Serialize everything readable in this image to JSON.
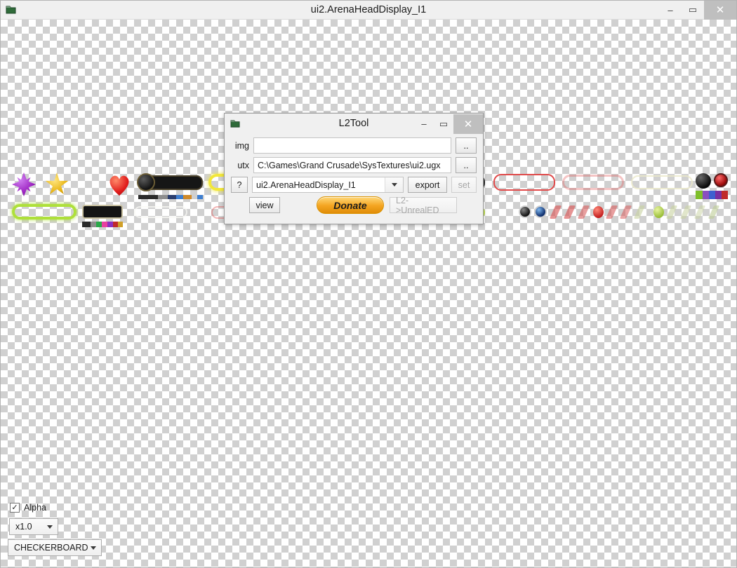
{
  "window": {
    "title": "ui2.ArenaHeadDisplay_I1",
    "icon": "folder-icon",
    "minimize_label": "–",
    "maximize_label": "▭",
    "close_label": "✕"
  },
  "viewer_controls": {
    "alpha_label": "Alpha",
    "alpha_checked": true,
    "check_glyph": "✓",
    "zoom_value": "x1.0",
    "background_value": "CHECKERBOARD"
  },
  "dialog": {
    "title": "L2Tool",
    "icon": "folder-icon",
    "minimize_label": "–",
    "maximize_label": "▭",
    "close_label": "✕",
    "img_label": "img",
    "img_value": "",
    "img_browse_label": "..",
    "utx_label": "utx",
    "utx_value": "C:\\Games\\Grand Crusade\\SysTextures\\ui2.ugx",
    "utx_browse_label": "..",
    "help_label": "?",
    "texture_value": "ui2.ArenaHeadDisplay_I1",
    "export_label": "export",
    "set_label": "set",
    "view_label": "view",
    "donate_label": "Donate",
    "unrealed_label": "L2->UnrealED"
  },
  "colors": {
    "accent": "#f5a623",
    "titlebar_bg": "#f0f0f0",
    "close_hover": "#bfbfbf",
    "checker_light": "#ffffff",
    "checker_dark": "#d0d0d0"
  }
}
